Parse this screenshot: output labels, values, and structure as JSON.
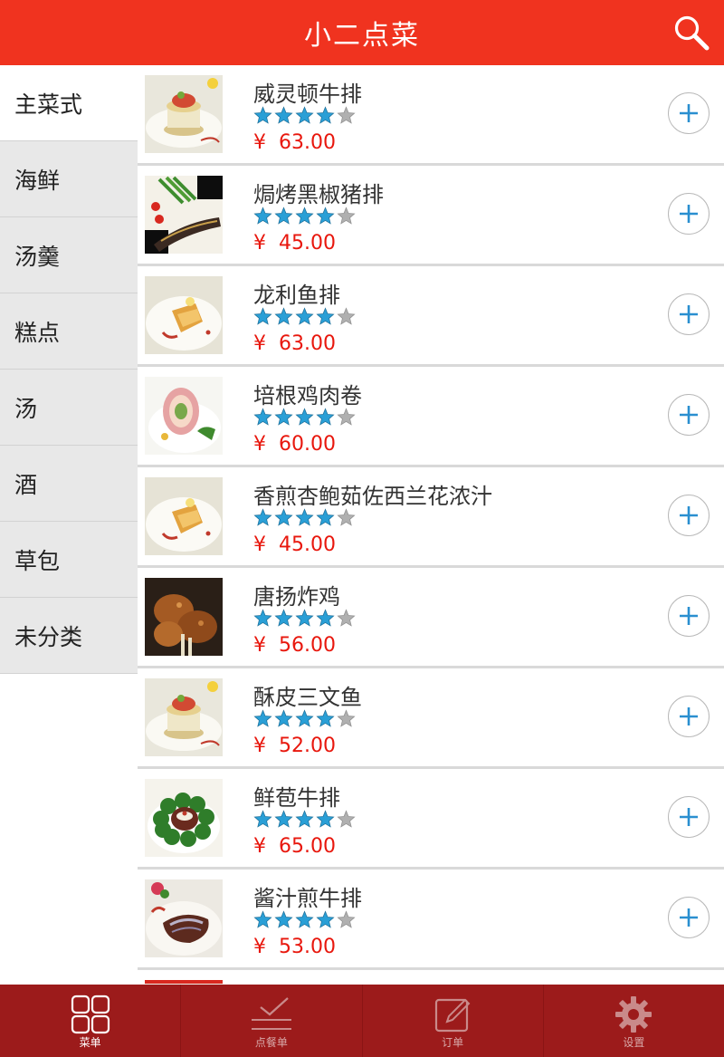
{
  "header": {
    "title": "小二点菜",
    "search_icon": "search-icon"
  },
  "categories": [
    {
      "label": "主菜式",
      "active": true
    },
    {
      "label": "海鲜",
      "active": false
    },
    {
      "label": "汤羹",
      "active": false
    },
    {
      "label": "糕点",
      "active": false
    },
    {
      "label": "汤",
      "active": false
    },
    {
      "label": "酒",
      "active": false
    },
    {
      "label": "草包",
      "active": false
    },
    {
      "label": "未分类",
      "active": false
    }
  ],
  "currency_symbol": "¥",
  "dishes": [
    {
      "name": "威灵顿牛排",
      "price": "63.00",
      "rating": 4,
      "image": "tower-plate-image"
    },
    {
      "name": "焗烤黑椒猪排",
      "price": "45.00",
      "rating": 4,
      "image": "pork-asparagus-image"
    },
    {
      "name": "龙利鱼排",
      "price": "63.00",
      "rating": 4,
      "image": "fish-fillet-image"
    },
    {
      "name": "培根鸡肉卷",
      "price": "60.00",
      "rating": 4,
      "image": "bacon-roll-image"
    },
    {
      "name": "香煎杏鲍茹佐西兰花浓汁",
      "price": "45.00",
      "rating": 4,
      "image": "fish-fillet-image"
    },
    {
      "name": "唐扬炸鸡",
      "price": "56.00",
      "rating": 4,
      "image": "fried-chicken-image"
    },
    {
      "name": "酥皮三文鱼",
      "price": "52.00",
      "rating": 4,
      "image": "tower-plate-image"
    },
    {
      "name": "鲜苞牛排",
      "price": "65.00",
      "rating": 4,
      "image": "broccoli-steak-image"
    },
    {
      "name": "酱汁煎牛排",
      "price": "53.00",
      "rating": 4,
      "image": "sauce-steak-image"
    }
  ],
  "tabs": [
    {
      "label": "菜单",
      "icon": "grid-icon",
      "active": true
    },
    {
      "label": "点餐单",
      "icon": "checklist-icon",
      "active": false
    },
    {
      "label": "订单",
      "icon": "edit-icon",
      "active": false
    },
    {
      "label": "设置",
      "icon": "gear-icon",
      "active": false
    }
  ],
  "colors": {
    "header": "#f0331f",
    "tabbar": "#9c1b1b",
    "price": "#e8170d",
    "star_filled": "#2a9fd6",
    "star_empty": "#b0b0b0",
    "add_button": "#2a8fd0"
  }
}
